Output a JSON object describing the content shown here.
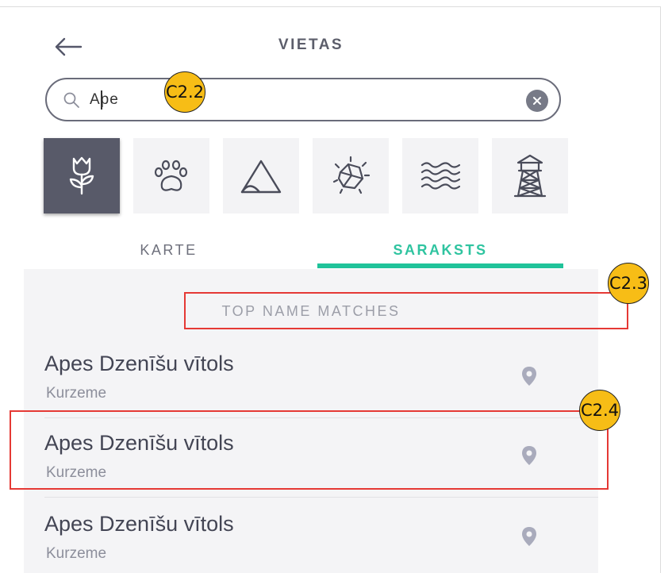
{
  "header": {
    "title": "VIETAS"
  },
  "search": {
    "value": "Ape",
    "placeholder": ""
  },
  "categories": [
    {
      "icon": "tulip-icon",
      "active": true
    },
    {
      "icon": "paw-icon",
      "active": false
    },
    {
      "icon": "mountain-icon",
      "active": false
    },
    {
      "icon": "rock-icon",
      "active": false
    },
    {
      "icon": "water-waves-icon",
      "active": false
    },
    {
      "icon": "watchtower-icon",
      "active": false
    }
  ],
  "tabs": [
    {
      "label": "KARTE",
      "active": false
    },
    {
      "label": "SARAKSTS",
      "active": true
    }
  ],
  "list": {
    "section_heading": "TOP NAME MATCHES",
    "items": [
      {
        "name": "Apes Dzenīšu vītols",
        "region": "Kurzeme"
      },
      {
        "name": "Apes Dzenīšu vītols",
        "region": "Kurzeme"
      },
      {
        "name": "Apes Dzenīšu vītols",
        "region": "Kurzeme"
      }
    ]
  },
  "annotations": [
    {
      "label": "C2.2"
    },
    {
      "label": "C2.3"
    },
    {
      "label": "C2.4"
    }
  ],
  "colors": {
    "accent": "#20c39a",
    "active_category_bg": "#585a69",
    "annotation_badge": "#f7bd16",
    "annotation_box": "#e53935"
  }
}
